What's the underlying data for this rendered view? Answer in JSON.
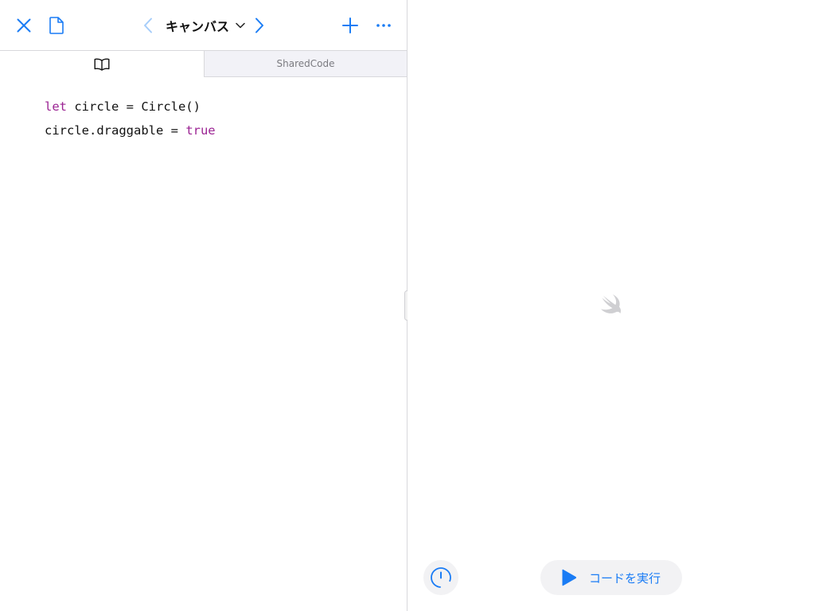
{
  "toolbar": {
    "title": "キャンバス",
    "icons": {
      "close": "close-icon",
      "document": "document-icon",
      "back": "chevron-left-icon",
      "title_dropdown": "chevron-down-icon",
      "forward": "chevron-right-icon",
      "add": "plus-icon",
      "more": "ellipsis-icon"
    }
  },
  "tabs": [
    {
      "icon": "book-icon",
      "label": ""
    },
    {
      "label": "SharedCode"
    }
  ],
  "code": {
    "lines": [
      {
        "keyword": "let",
        "rest": " circle = Circle()"
      },
      {
        "text": "circle.draggable = ",
        "keyword": "true"
      }
    ]
  },
  "live_view": {
    "placeholder_icon": "swift-logo-icon",
    "meter_icon": "speedometer-icon",
    "run_button": {
      "icon": "play-icon",
      "label": "コードを実行"
    }
  },
  "colors": {
    "accent": "#1a7cf5",
    "keyword": "#9b2393",
    "disabled_accent": "#a6cdfa",
    "tab_inactive_bg": "#f2f2f7"
  }
}
